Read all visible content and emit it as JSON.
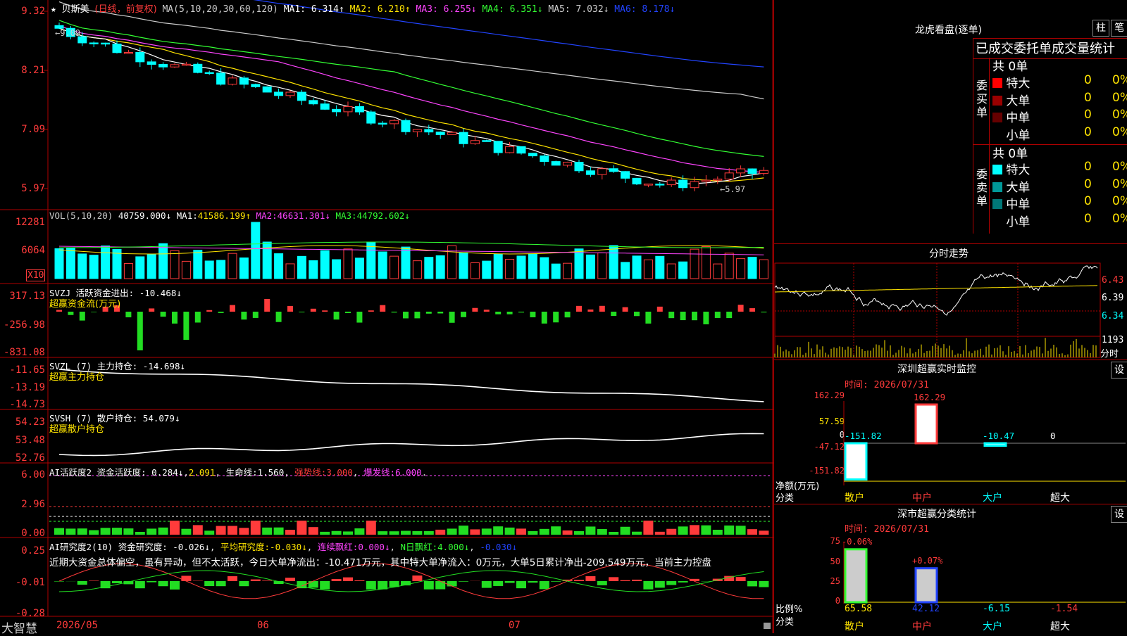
{
  "kline": {
    "title_star": "★",
    "stock": "贝斯美",
    "period": "(日线，前复权)",
    "ma_header": "MA(5,10,20,30,60,120)",
    "ma": [
      {
        "label": "MA1:",
        "value": "6.314↑",
        "color": "#ffffff"
      },
      {
        "label": "MA2:",
        "value": "6.210↑",
        "color": "#ffe400"
      },
      {
        "label": "MA3:",
        "value": "6.255↓",
        "color": "#ff44ff"
      },
      {
        "label": "MA4:",
        "value": "6.351↓",
        "color": "#33ff33"
      },
      {
        "label": "MA5:",
        "value": "7.032↓",
        "color": "#cccccc"
      },
      {
        "label": "MA6:",
        "value": "8.178↓",
        "color": "#2244ff"
      }
    ],
    "yaxis": [
      "9.32",
      "8.21",
      "7.09",
      "5.97"
    ],
    "high_mark": "←9.09",
    "low_mark": "←5.97"
  },
  "vol": {
    "header": "VOL(5,10,20)",
    "value": "40759.000↓",
    "ma1_label": "MA1:",
    "ma1": "41586.199↑",
    "ma2_label": "MA2:",
    "ma2": "46631.301↓",
    "ma3_label": "MA3:",
    "ma3": "44792.602↓",
    "yaxis": [
      "12281",
      "6064"
    ],
    "unit": "X10"
  },
  "svzj": {
    "header": "SVZJ  活跃资金进出:",
    "value": "-10.468↓",
    "subtitle": "超赢资金流(万元)",
    "yaxis": [
      "317.13",
      "-256.98",
      "-831.08"
    ]
  },
  "svzl": {
    "header": "SVZL (7) 主力持仓:",
    "value": "-14.698↓",
    "subtitle": "超赢主力持仓",
    "yaxis": [
      "-11.65",
      "-13.19",
      "-14.73"
    ]
  },
  "svsh": {
    "header": "SVSH (7) 散户持仓:",
    "value": "54.079↓",
    "subtitle": "超赢散户持仓",
    "yaxis": [
      "54.23",
      "53.48",
      "52.76"
    ]
  },
  "ai1": {
    "header": "AI活跃度2 资金活跃度:",
    "v1": "0.284↓",
    "v2": "2.091",
    "life_label": "生命线:",
    "life": "1.560",
    "strong_label": "强势线:",
    "strong": "3.000",
    "burst_label": "爆发线:",
    "burst": "6.000",
    "yaxis": [
      "6.00",
      "2.96",
      "0.00"
    ]
  },
  "ai2": {
    "header": "AI研究度2(10) 资金研究度:",
    "v1": "-0.026↓",
    "avg_label": "平均研究度:",
    "avg": "-0.030↓",
    "red_label": "连续飘红:",
    "red": "0.000↓",
    "nred_label": "N日飘红:",
    "nred": "4.000↓",
    "last": "-0.030↓",
    "comment": "近期大资金总体偏空，虽有异动，但不太活跃，今日大单净流出：-10.471万元，其中特大单净流入：0万元，大单5日累计净出-209.549万元，当前主力控盘",
    "yaxis": [
      "0.25",
      "-0.01",
      "-0.28"
    ]
  },
  "xaxis": {
    "brand": "大智慧",
    "labels": [
      "2026/05",
      "06",
      "07"
    ]
  },
  "dragon": {
    "title": "龙虎看盘(逐单)",
    "tab1": "柱",
    "tab2": "笔",
    "heading": "已成交委托单成交量统计",
    "buy_label": "委买单",
    "sell_label": "委卖单",
    "buy_total": "共 0单",
    "sell_total": "共 0单",
    "buy_rows": [
      {
        "name": "特大",
        "color": "#ff0000",
        "count": "0",
        "pct": "0%"
      },
      {
        "name": "大单",
        "color": "#990000",
        "count": "0",
        "pct": "0%"
      },
      {
        "name": "中单",
        "color": "#660000",
        "count": "0",
        "pct": "0%"
      },
      {
        "name": "小单",
        "color": "#000000",
        "count": "0",
        "pct": "0%"
      }
    ],
    "sell_rows": [
      {
        "name": "特大",
        "color": "#00ffff",
        "count": "0",
        "pct": "0%"
      },
      {
        "name": "大单",
        "color": "#009999",
        "count": "0",
        "pct": "0%"
      },
      {
        "name": "中单",
        "color": "#007777",
        "count": "0",
        "pct": "0%"
      },
      {
        "name": "小单",
        "color": "#000000",
        "count": "0",
        "pct": "0%"
      }
    ]
  },
  "intraday": {
    "title": "分时走势",
    "yaxis": [
      "6.43",
      "6.39",
      "6.34"
    ],
    "vol_label": "1193",
    "vol_unit": "分时"
  },
  "monitor": {
    "title": "深圳超赢实时监控",
    "set": "设",
    "time": "时间: 2026/07/31",
    "yaxis": [
      "162.29",
      "57.59",
      "0",
      "-47.12",
      "-151.82"
    ],
    "value_labels": [
      "-151.82",
      "162.29",
      "-10.47",
      "0"
    ],
    "values": [
      -151.82,
      162.29,
      -10.47,
      0
    ],
    "unit1": "净额(万元)",
    "unit2": "分类",
    "cats": [
      "散户",
      "中户",
      "大户",
      "超大"
    ]
  },
  "classify": {
    "title": "深市超赢分类统计",
    "set": "设",
    "time": "时间: 2026/07/31",
    "yaxis": [
      "75",
      "50",
      "25",
      "0"
    ],
    "top_labels": [
      "-0.06%",
      "+0.07%"
    ],
    "bottom_values": [
      "65.58",
      "42.12",
      "-6.15",
      "-1.54"
    ],
    "values": [
      65.58,
      42.12,
      -6.15,
      -1.54
    ],
    "unit1": "比例%",
    "unit2": "分类",
    "cats": [
      "散户",
      "中户",
      "大户",
      "超大"
    ]
  },
  "colors": {
    "up": "#ff3b3b",
    "down": "#00ffff",
    "grid": "#b00000",
    "ma_white": "#ffffff",
    "ma_yellow": "#ffe400",
    "ma_magenta": "#ff44ff",
    "ma_green": "#33ff33",
    "ma_gray": "#cccccc",
    "ma_blue": "#2244ff"
  }
}
